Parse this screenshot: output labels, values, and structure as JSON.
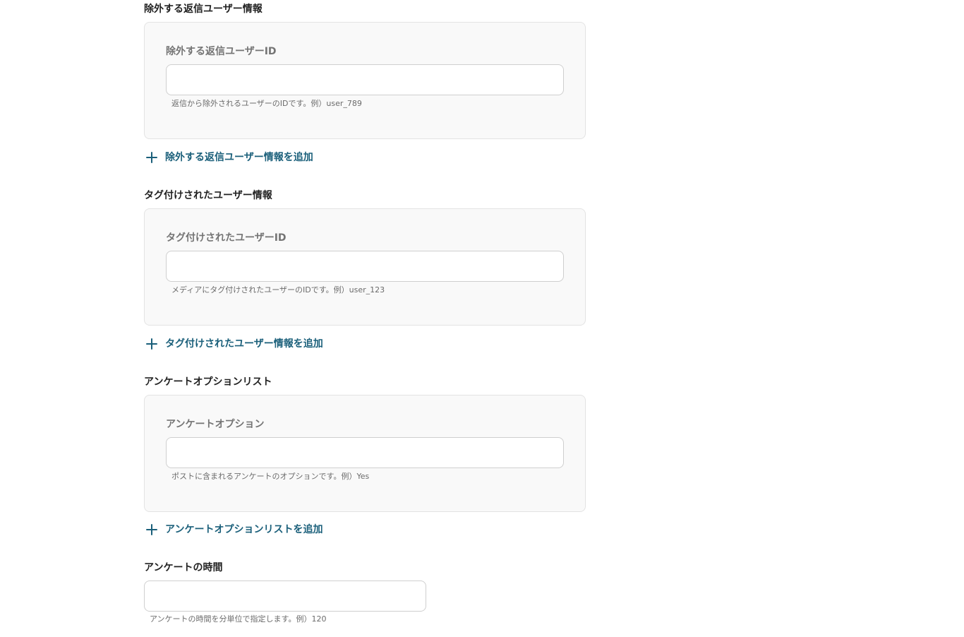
{
  "sections": [
    {
      "title": "除外する返信ユーザー情報",
      "field_label": "除外する返信ユーザーID",
      "input_value": "",
      "hint": "返信から除外されるユーザーのIDです。例）user_789",
      "add_label": "除外する返信ユーザー情報を追加"
    },
    {
      "title": "タグ付けされたユーザー情報",
      "field_label": "タグ付けされたユーザーID",
      "input_value": "",
      "hint": "メディアにタグ付けされたユーザーのIDです。例）user_123",
      "add_label": "タグ付けされたユーザー情報を追加"
    },
    {
      "title": "アンケートオプションリスト",
      "field_label": "アンケートオプション",
      "input_value": "",
      "hint": "ポストに含まれるアンケートのオプションです。例）Yes",
      "add_label": "アンケートオプションリストを追加"
    }
  ],
  "poll_duration": {
    "title": "アンケートの時間",
    "input_value": "",
    "hint": "アンケートの時間を分単位で指定します。例）120"
  },
  "colors": {
    "accent": "#1a5f7a",
    "panel_bg": "#f9f9f9",
    "border": "#e3e3e3"
  }
}
